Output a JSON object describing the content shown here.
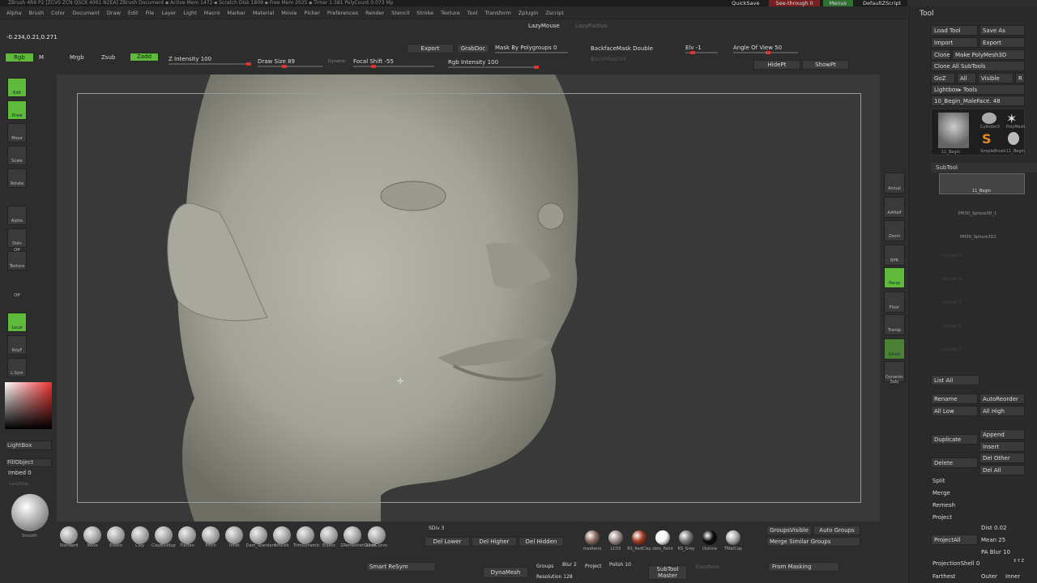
{
  "titlebar": {
    "text": "ZBrush 4R6 P2 [ZCV0 ZCN QSCK 4061 N2EA]   ZBrush Document   ▪ Active Mem 1472 ▪ Scratch Disk 1809 ▪ Free Mem 2025 ▪ Timer 1.381  PolyCount 0.073 Mp"
  },
  "topright": {
    "quicksave": "QuickSave",
    "seethrough": "See-through 0",
    "menus": "Menus",
    "script": "DefaultZScript"
  },
  "menu": [
    "Alpha",
    "Brush",
    "Color",
    "Document",
    "Draw",
    "Edit",
    "File",
    "Layer",
    "Light",
    "Macro",
    "Marker",
    "Material",
    "Movie",
    "Picker",
    "Preferences",
    "Render",
    "Stencil",
    "Stroke",
    "Texture",
    "Tool",
    "Transform",
    "Zplugin",
    "Zscript"
  ],
  "coords": "-0.234,0.21,0.271",
  "lazymouse": "LazyMouse",
  "lazyradius": "LazyRadius",
  "top": {
    "export": "Export",
    "grabdoc": "GrabDoc",
    "mask_by": "Mask By Polygroups 0",
    "backface": "BackfaceMask Double",
    "backmaskint": "BackMaskInt",
    "elv": "Elv -1",
    "angle": "Angle Of View 50",
    "hidept": "HidePt",
    "showpt": "ShowPt",
    "rgb": "Rgb",
    "m": "M",
    "mrgb": "Mrgb",
    "zsub": "Zsub",
    "zadd": "Zadd",
    "zintensity": "Z Intensity 100",
    "drawsize": "Draw Size 89",
    "dynamic": "Dynamic",
    "focal": "Focal Shift -55",
    "rgbint": "Rgb Intensity 100"
  },
  "left": {
    "edit": "Edit",
    "draw": "Draw",
    "move": "Move",
    "scale": "Scale",
    "rotate": "Rotate",
    "alpha": "Alpha Off",
    "dots": "Dots",
    "texture": "Texture Off",
    "local": "Local",
    "polyf": "PolyF",
    "lsym": "L.Sym",
    "lightbox": "LightBox",
    "fillobject": "FillObject",
    "imbed": "Imbed 0",
    "lazystep": "LazyStep",
    "smooth": "Smooth"
  },
  "rightvp": [
    "Actual",
    "AAHalf",
    "Zoom",
    "BPR",
    "Persp",
    "Floor",
    "Transp",
    "Ghost",
    "Dynamic Solo"
  ],
  "tool": {
    "title": "Tool",
    "load": "Load Tool",
    "saveas": "Save As",
    "import": "Import",
    "export": "Export",
    "clone": "Clone",
    "make": "Make PolyMesh3D",
    "cloneall": "Clone All SubTools",
    "goz": "GoZ",
    "all": "All",
    "visible": "Visible",
    "r": "R",
    "lightbox": "Lightbox▸ Tools",
    "current": "10_Begin_MaleFace. 48",
    "thumb1": "11_Begin",
    "thumb2": "Cylinder3",
    "thumb3": "PolyMesh",
    "thumb4": "SimpleBrush",
    "thumb5": "11_Begin",
    "subtool": "SubTool",
    "st1": "11_Begin",
    "st2": "PM3D_Sphere3D_1",
    "st3": "PM3D_Sphere3D1",
    "unused": [
      "Unused 3",
      "Unused 4",
      "Unused 5",
      "Unused 6",
      "Unused 7"
    ],
    "listall": "List All",
    "rename": "Rename",
    "autoreorder": "AutoReorder",
    "alllow": "All Low",
    "allhigh": "All High",
    "duplicate": "Duplicate",
    "append": "Append",
    "insert": "Insert",
    "delete": "Delete",
    "delother": "Del Other",
    "delall": "Del All",
    "split": "Split",
    "merge": "Merge",
    "remesh": "Remesh",
    "project": "Project",
    "projectall": "ProjectAll",
    "dist": "Dist 0.02",
    "mean": "Mean 25",
    "pablur": "PA Blur 10",
    "projshell": "ProjectionShell 0",
    "xyz": "X Y Z",
    "farthest": "Farthest",
    "outer": "Outer",
    "inner": "Inner"
  },
  "brushes": [
    "Standard",
    "Move",
    "Elastic",
    "Clay",
    "ClayBuildup",
    "Flatten",
    "Pinch",
    "Inflat",
    "Dam_Standard",
    "hPolish",
    "TrimDynamic",
    "Elastic",
    "ZRemesherGuide",
    "SliceCurve"
  ],
  "bottom": {
    "sdiv": "SDiv 3",
    "dellower": "Del Lower",
    "delhigher": "Del Higher",
    "delhidden": "Del Hidden",
    "groupsvis": "GroupsVisible",
    "autogroups": "Auto Groups",
    "mergesim": "Merge Similar Groups",
    "smartresym": "Smart ReSym",
    "dynamesh": "DynaMesh",
    "groups": "Groups",
    "blur": "Blur 2",
    "project": "Project",
    "polish": "Polish 10",
    "resolution": "Resolution 128",
    "subtoolmaster": "SubTool Master",
    "transform": "Transform",
    "frommasking": "From Masking"
  },
  "materials": [
    "matAeroi",
    "LC03",
    "RS_RedClay",
    "zbro_Paint",
    "RS_Grey",
    "Outline",
    "TMatCap"
  ],
  "mat_colors": [
    "#8a6a5a",
    "#9a8a88",
    "#a03a20",
    "#f4f4f4",
    "#777777",
    "#0a0a0a",
    "#aaaaaa"
  ]
}
